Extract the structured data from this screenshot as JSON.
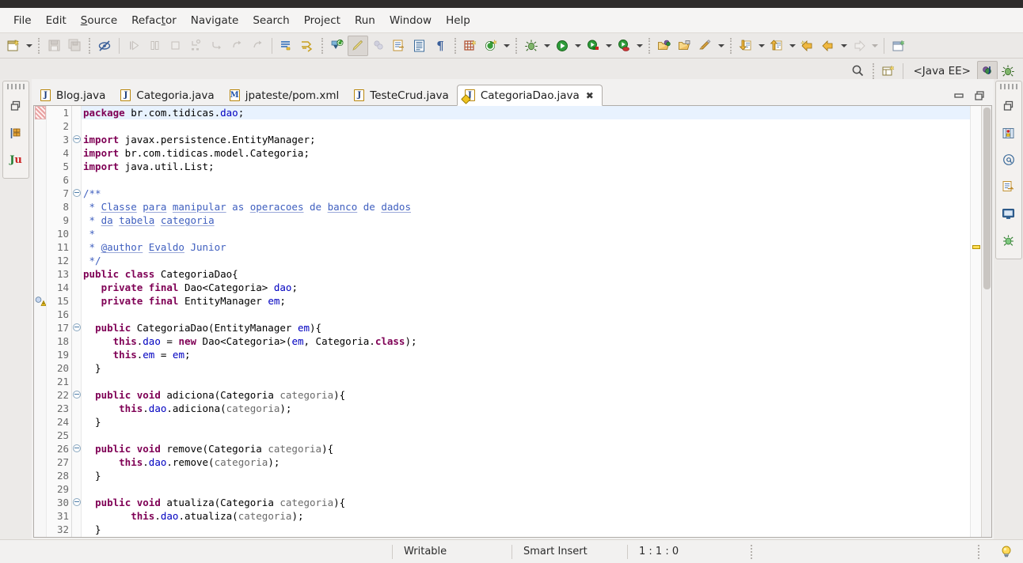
{
  "window": {
    "perspective_label": "<Java EE>"
  },
  "menubar": {
    "items": [
      {
        "label": "File",
        "mnemonic": ""
      },
      {
        "label": "Edit",
        "mnemonic": ""
      },
      {
        "label": "Source",
        "mnemonic": "S"
      },
      {
        "label": "Refactor",
        "mnemonic": "t"
      },
      {
        "label": "Navigate",
        "mnemonic": ""
      },
      {
        "label": "Search",
        "mnemonic": ""
      },
      {
        "label": "Project",
        "mnemonic": ""
      },
      {
        "label": "Run",
        "mnemonic": ""
      },
      {
        "label": "Window",
        "mnemonic": ""
      },
      {
        "label": "Help",
        "mnemonic": ""
      }
    ]
  },
  "toolbar": {
    "groups": [
      {
        "name": "new",
        "icons": [
          "new-wizard-icon",
          "dropdown-arrow"
        ]
      },
      {
        "name": "save",
        "icons": [
          "save-icon",
          "save-all-icon"
        ]
      },
      {
        "name": "print",
        "icons": [
          "no-print-icon"
        ]
      },
      {
        "name": "debug-controls",
        "icons": [
          "resume-icon",
          "suspend-icon",
          "terminate-icon",
          "step-into-icon",
          "step-over-icon",
          "step-return-icon",
          "drop-to-frame-icon"
        ]
      },
      {
        "name": "build",
        "icons": [
          "build-all-icon",
          "skip-breakpoints-icon"
        ]
      },
      {
        "name": "annotate",
        "icons": [
          "toggle-mark-occurrences-icon",
          "highlight-icon",
          "link-icon",
          "open-task-icon",
          "show-whitespace-icon",
          "pilcrow-icon"
        ]
      },
      {
        "name": "new-class",
        "icons": [
          "new-java-class-icon",
          "new-java-project-icon",
          "dropdown-arrow"
        ]
      },
      {
        "name": "run",
        "icons": [
          "debug-icon",
          "dropdown-arrow",
          "run-icon",
          "dropdown-arrow",
          "run-server-icon",
          "dropdown-arrow",
          "run-profile-icon",
          "dropdown-arrow"
        ]
      },
      {
        "name": "open-type",
        "icons": [
          "open-type-icon",
          "open-task-icon",
          "external-tools-icon",
          "dropdown-arrow"
        ]
      },
      {
        "name": "navigation",
        "icons": [
          "next-annotation-icon",
          "dropdown-arrow",
          "previous-annotation-icon",
          "dropdown-arrow",
          "back-icon",
          "forward-icon",
          "dropdown-arrow",
          "forward-disabled-icon",
          "dropdown-arrow-disabled"
        ]
      },
      {
        "name": "new-window",
        "icons": [
          "new-window-icon"
        ]
      }
    ]
  },
  "perspective_bar": {
    "search_icon": "search-icon",
    "open-perspective-icon": "open-perspective-icon",
    "label": "<Java EE>",
    "perspectives": [
      {
        "name": "java-ee-perspective",
        "active": true
      },
      {
        "name": "debug-perspective",
        "active": false
      }
    ]
  },
  "left_rail": {
    "icons": [
      "restore-view-icon",
      "package-explorer-icon",
      "junit-icon"
    ],
    "junit_label": "JU"
  },
  "right_rail": {
    "icons": [
      "restore-view-icon",
      "outline-icon",
      "at-icon",
      "javadoc-icon",
      "console-icon",
      "servers-icon"
    ]
  },
  "editor_tabs": {
    "tabs": [
      {
        "label": "Blog.java",
        "icon": "java-file-icon",
        "letter": "J",
        "active": false,
        "closable": false
      },
      {
        "label": "Categoria.java",
        "icon": "java-file-icon",
        "letter": "J",
        "active": false,
        "closable": false
      },
      {
        "label": "jpateste/pom.xml",
        "icon": "maven-file-icon",
        "letter": "M",
        "active": false,
        "closable": false
      },
      {
        "label": "TesteCrud.java",
        "icon": "java-file-icon",
        "letter": "J",
        "active": false,
        "closable": false
      },
      {
        "label": "CategoriaDao.java",
        "icon": "java-file-warning-icon",
        "letter": "J",
        "active": true,
        "closable": true,
        "close_glyph": "✖"
      }
    ],
    "minimize_label": "minimize-icon",
    "maximize_label": "maximize-icon"
  },
  "code": {
    "file": "CategoriaDao.java",
    "current_line": 1,
    "warning_line": 15,
    "fold_lines": [
      3,
      7,
      17,
      22,
      26,
      30
    ],
    "lines": [
      {
        "n": 1,
        "text": "package br.com.tidicas.dao;"
      },
      {
        "n": 2,
        "text": ""
      },
      {
        "n": 3,
        "text": "import javax.persistence.EntityManager;"
      },
      {
        "n": 4,
        "text": "import br.com.tidicas.model.Categoria;"
      },
      {
        "n": 5,
        "text": "import java.util.List;"
      },
      {
        "n": 6,
        "text": ""
      },
      {
        "n": 7,
        "text": "/**"
      },
      {
        "n": 8,
        "text": " * Classe para manipular as operacoes de banco de dados"
      },
      {
        "n": 9,
        "text": " * da tabela categoria"
      },
      {
        "n": 10,
        "text": " *"
      },
      {
        "n": 11,
        "text": " * @author Evaldo Junior"
      },
      {
        "n": 12,
        "text": " */"
      },
      {
        "n": 13,
        "text": "public class CategoriaDao{"
      },
      {
        "n": 14,
        "text": "   private final Dao<Categoria> dao;"
      },
      {
        "n": 15,
        "text": "   private final EntityManager em;"
      },
      {
        "n": 16,
        "text": ""
      },
      {
        "n": 17,
        "text": "  public CategoriaDao(EntityManager em){"
      },
      {
        "n": 18,
        "text": "     this.dao = new Dao<Categoria>(em, Categoria.class);"
      },
      {
        "n": 19,
        "text": "     this.em = em;"
      },
      {
        "n": 20,
        "text": "  }"
      },
      {
        "n": 21,
        "text": ""
      },
      {
        "n": 22,
        "text": "  public void adiciona(Categoria categoria){"
      },
      {
        "n": 23,
        "text": "      this.dao.adiciona(categoria);"
      },
      {
        "n": 24,
        "text": "  }"
      },
      {
        "n": 25,
        "text": ""
      },
      {
        "n": 26,
        "text": "  public void remove(Categoria categoria){"
      },
      {
        "n": 27,
        "text": "      this.dao.remove(categoria);"
      },
      {
        "n": 28,
        "text": "  }"
      },
      {
        "n": 29,
        "text": ""
      },
      {
        "n": 30,
        "text": "  public void atualiza(Categoria categoria){"
      },
      {
        "n": 31,
        "text": "        this.dao.atualiza(categoria);"
      },
      {
        "n": 32,
        "text": "  }"
      }
    ]
  },
  "statusbar": {
    "writable": "Writable",
    "insert_mode": "Smart Insert",
    "position": "1 : 1 : 0",
    "tip_icon": "lightbulb-icon"
  },
  "colors": {
    "keyword": "#7f0055",
    "comment": "#3f5fbf",
    "field": "#0000c0",
    "parameter": "#6a6a6a",
    "current_line": "#e8f2fe",
    "warning": "#ffdd55",
    "chrome": "#ebe9e7"
  }
}
